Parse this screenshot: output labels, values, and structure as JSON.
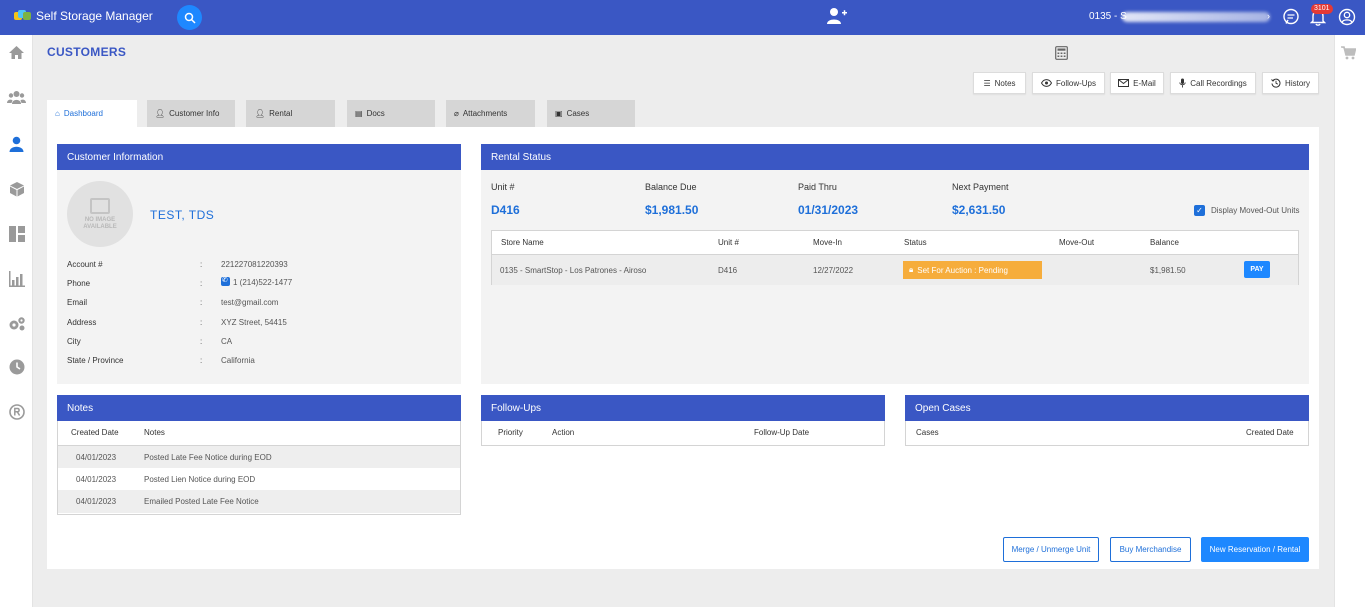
{
  "app": {
    "title": "Self Storage Manager"
  },
  "topbar": {
    "store_prefix": "0135 - S",
    "notification_count": "3101"
  },
  "page": {
    "title": "CUSTOMERS"
  },
  "actions": {
    "notes": "Notes",
    "follow_ups": "Follow-Ups",
    "email": "E-Mail",
    "call_recordings": "Call Recordings",
    "history": "History"
  },
  "tabs": [
    "Dashboard",
    "Customer Info",
    "Rental",
    "Docs",
    "Attachments",
    "Cases"
  ],
  "customer_info": {
    "header": "Customer Information",
    "no_image_1": "NO IMAGE",
    "no_image_2": "AVAILABLE",
    "name": "TEST, TDS",
    "fields": [
      {
        "label": "Account #",
        "value": "221227081220393"
      },
      {
        "label": "Phone",
        "value": "1 (214)522-1477"
      },
      {
        "label": "Email",
        "value": "test@gmail.com"
      },
      {
        "label": "Address",
        "value": "XYZ Street, 54415"
      },
      {
        "label": "City",
        "value": "CA"
      },
      {
        "label": "State / Province",
        "value": "California"
      }
    ]
  },
  "rental_status": {
    "header": "Rental Status",
    "summary": [
      {
        "label": "Unit #",
        "value": "D416"
      },
      {
        "label": "Balance Due",
        "value": "$1,981.50"
      },
      {
        "label": "Paid Thru",
        "value": "01/31/2023"
      },
      {
        "label": "Next Payment",
        "value": "$2,631.50"
      }
    ],
    "display_moved_out": "Display Moved-Out Units",
    "columns": [
      "Store Name",
      "Unit #",
      "Move-In",
      "Status",
      "Move-Out",
      "Balance"
    ],
    "row": {
      "store": "0135 - SmartStop - Los Patrones - Airoso",
      "unit": "D416",
      "move_in": "12/27/2022",
      "status": "Set For Auction : Pending",
      "move_out": "",
      "balance": "$1,981.50",
      "pay": "PAY"
    }
  },
  "notes": {
    "header": "Notes",
    "columns": [
      "Created Date",
      "Notes"
    ],
    "rows": [
      {
        "date": "04/01/2023",
        "note": "Posted Late Fee Notice during EOD"
      },
      {
        "date": "04/01/2023",
        "note": "Posted Lien Notice during EOD"
      },
      {
        "date": "04/01/2023",
        "note": "Emailed Posted Late Fee Notice"
      }
    ]
  },
  "follow_ups": {
    "header": "Follow-Ups",
    "columns": [
      "Priority",
      "Action",
      "Follow-Up Date"
    ]
  },
  "open_cases": {
    "header": "Open Cases",
    "columns": [
      "Cases",
      "Created Date"
    ]
  },
  "buttons": {
    "merge": "Merge / Unmerge Unit",
    "merchandise": "Buy Merchandise",
    "new_reservation": "New Reservation / Rental"
  },
  "colors": {
    "primary": "#3a57c4",
    "accent": "#1e88ff",
    "warning": "#f6ad3c"
  }
}
